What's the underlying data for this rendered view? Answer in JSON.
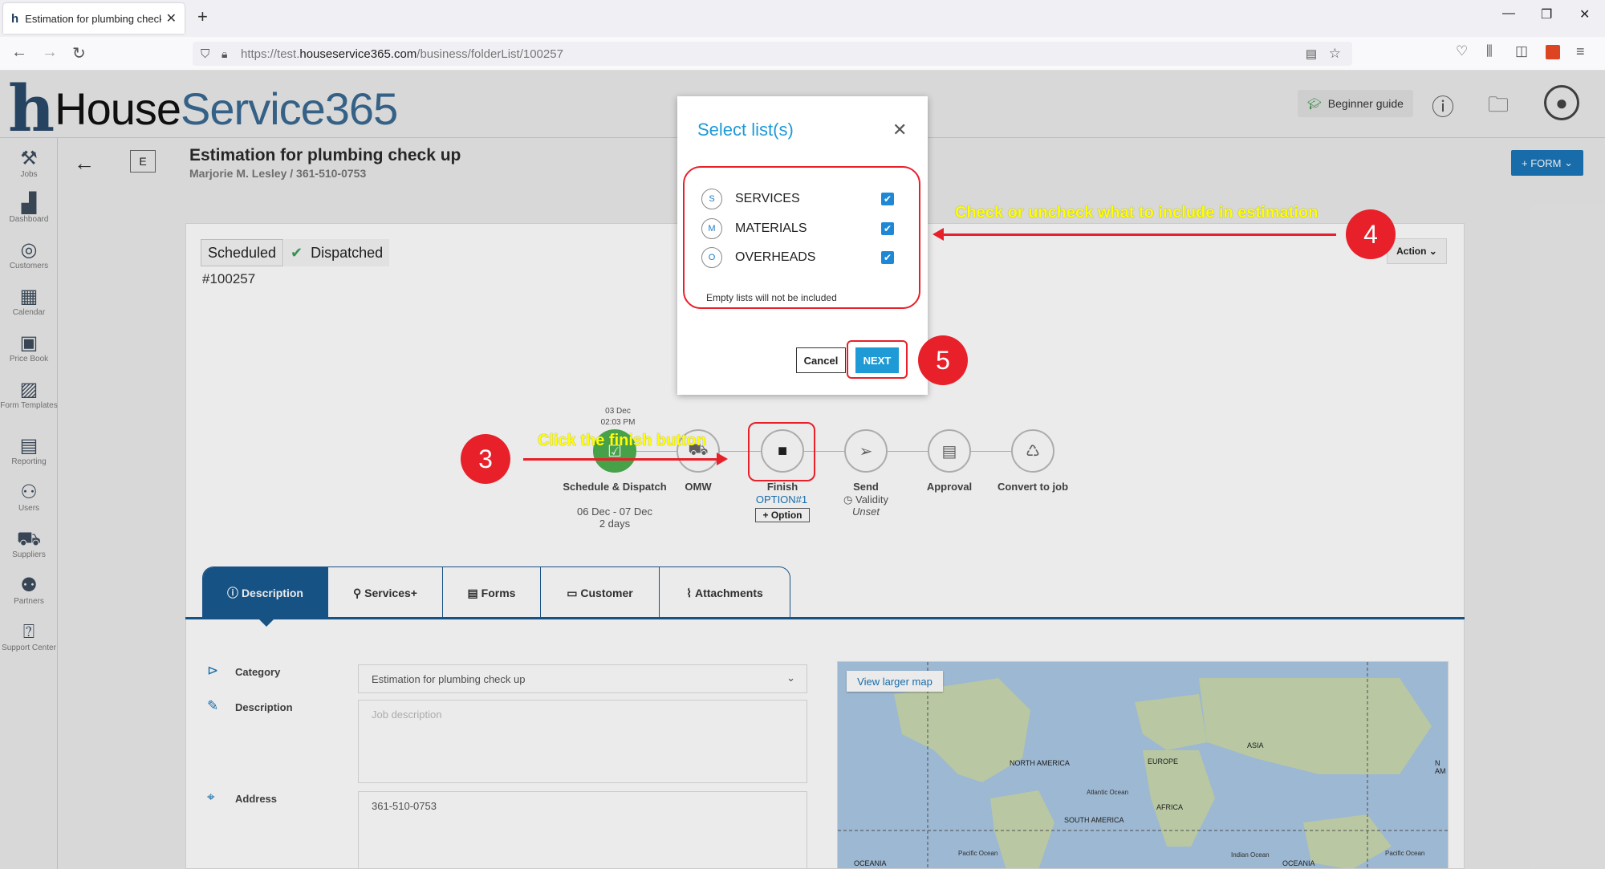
{
  "browser": {
    "tab_title": "Estimation for plumbing check",
    "url_prefix": "https://test.",
    "url_domain": "houseservice365.com",
    "url_path": "/business/folderList/100257"
  },
  "app": {
    "logo_house": "House",
    "logo_service": "Service365",
    "guide_label": "Beginner guide",
    "form_button": "+ FORM"
  },
  "sidebar": {
    "items": [
      {
        "label": "Jobs",
        "icon": "tools-icon"
      },
      {
        "label": "Dashboard",
        "icon": "chart-icon"
      },
      {
        "label": "Customers",
        "icon": "customers-icon"
      },
      {
        "label": "Calendar",
        "icon": "calendar-icon"
      },
      {
        "label": "Price Book",
        "icon": "pricebook-icon"
      },
      {
        "label": "Form Templates",
        "icon": "form-icon"
      },
      {
        "label": "Reporting",
        "icon": "reporting-icon"
      },
      {
        "label": "Users",
        "icon": "users-icon"
      },
      {
        "label": "Suppliers",
        "icon": "truck-icon"
      },
      {
        "label": "Partners",
        "icon": "partners-icon"
      },
      {
        "label": "Support Center",
        "icon": "help-icon"
      }
    ]
  },
  "job": {
    "badge": "E",
    "title": "Estimation for plumbing check up",
    "subtitle": "Marjorie M. Lesley / 361-510-0753",
    "status_scheduled": "Scheduled",
    "status_dispatched": "Dispatched",
    "id": "#100257",
    "action_label": "Action"
  },
  "workflow": {
    "date_line1": "03 Dec",
    "date_line2": "02:03 PM",
    "steps": [
      {
        "label": "Schedule & Dispatch",
        "detail1": "06 Dec - 07 Dec",
        "detail2": "2 days"
      },
      {
        "label": "OMW"
      },
      {
        "label": "Finish",
        "option_link": "OPTION#1",
        "option_button": "+ Option"
      },
      {
        "label": "Send",
        "detail1": "Validity",
        "detail2": "Unset"
      },
      {
        "label": "Approval"
      },
      {
        "label": "Convert to job"
      }
    ]
  },
  "tabs": [
    {
      "label": "Description",
      "icon": "info-icon"
    },
    {
      "label": "Services+",
      "icon": "wrench-icon"
    },
    {
      "label": "Forms",
      "icon": "document-icon"
    },
    {
      "label": "Customer",
      "icon": "id-card-icon"
    },
    {
      "label": "Attachments",
      "icon": "paperclip-icon"
    }
  ],
  "fields": {
    "category_label": "Category",
    "category_value": "Estimation for plumbing check up",
    "description_label": "Description",
    "description_placeholder": "Job description",
    "address_label": "Address",
    "address_value": "361-510-0753"
  },
  "map": {
    "view_larger": "View larger map",
    "labels": [
      "NORTH AMERICA",
      "EUROPE",
      "ASIA",
      "AFRICA",
      "SOUTH AMERICA",
      "OCEANIA",
      "OCEANIA",
      "Atlantic Ocean",
      "Pacific Ocean",
      "Indian Ocean",
      "Pacific Ocean",
      "N AM"
    ]
  },
  "modal": {
    "title": "Select list(s)",
    "items": [
      {
        "letter": "S",
        "label": "SERVICES",
        "checked": true
      },
      {
        "letter": "M",
        "label": "MATERIALS",
        "checked": true
      },
      {
        "letter": "O",
        "label": "OVERHEADS",
        "checked": true
      }
    ],
    "note": "Empty lists will not be included",
    "cancel": "Cancel",
    "next": "NEXT"
  },
  "annotations": {
    "step3_num": "3",
    "step3_text": "Click the finish button",
    "step4_num": "4",
    "step4_text": "Check or uncheck what to include in estimation",
    "step5_num": "5"
  },
  "colors": {
    "accent": "#1e9ad6",
    "brand_dark": "#1a5a91",
    "annotation_red": "#e8202a",
    "annotation_yellow": "#ffff00"
  }
}
